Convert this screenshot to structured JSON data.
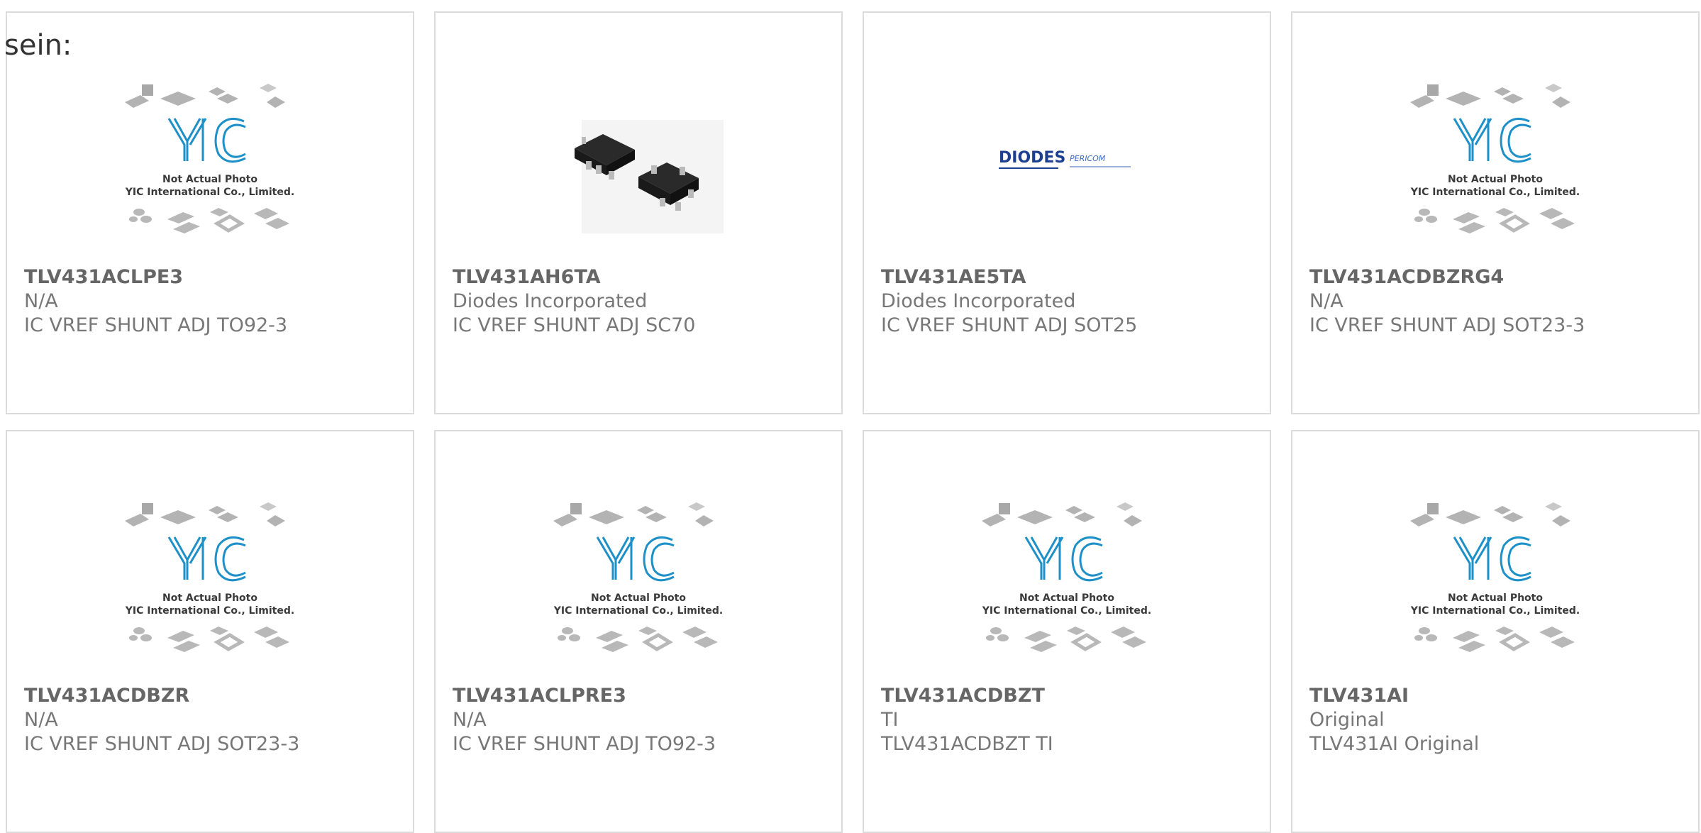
{
  "intro_text": "sein:",
  "placeholder": {
    "line1": "Not Actual Photo",
    "line2": "YIC International Co., Limited.",
    "logo": "YIC"
  },
  "diodes_logo": {
    "brand": "DIODES",
    "partner": "PERICOM"
  },
  "colors": {
    "accent": "#e8421a",
    "bar": "#3d3d3d",
    "logo_blue": "#1e90c8",
    "diodes_blue": "#1d3f8f"
  },
  "products": [
    {
      "part": "TLV431ACLPE3",
      "manufacturer": "N/A",
      "description": "IC VREF SHUNT ADJ TO92-3",
      "image": "placeholder"
    },
    {
      "part": "TLV431AH6TA",
      "manufacturer": "Diodes Incorporated",
      "description": "IC VREF SHUNT ADJ SC70",
      "image": "sc70-package"
    },
    {
      "part": "TLV431AE5TA",
      "manufacturer": "Diodes Incorporated",
      "description": "IC VREF SHUNT ADJ SOT25",
      "image": "diodes-logo"
    },
    {
      "part": "TLV431ACDBZRG4",
      "manufacturer": "N/A",
      "description": "IC VREF SHUNT ADJ SOT23-3",
      "image": "placeholder"
    },
    {
      "part": "TLV431ACDBZR",
      "manufacturer": "N/A",
      "description": "IC VREF SHUNT ADJ SOT23-3",
      "image": "placeholder"
    },
    {
      "part": "TLV431ACLPRE3",
      "manufacturer": "N/A",
      "description": "IC VREF SHUNT ADJ TO92-3",
      "image": "placeholder"
    },
    {
      "part": "TLV431ACDBZT",
      "manufacturer": "TI",
      "description": "TLV431ACDBZT TI",
      "image": "placeholder"
    },
    {
      "part": "TLV431AI",
      "manufacturer": "Original",
      "description": "TLV431AI Original",
      "image": "placeholder"
    }
  ]
}
